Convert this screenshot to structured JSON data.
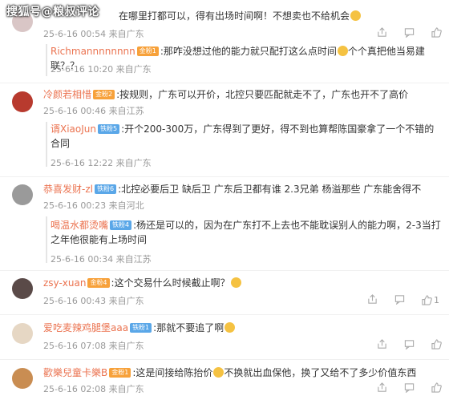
{
  "watermark": "搜狐号@粮叔评论",
  "comments": [
    {
      "avatar_color": "#d9c6c6",
      "text": "在哪里打都可以，得有出场时间啊！不想卖也不给机会",
      "meta": "25-6-16 00:54 来自广东",
      "reply": {
        "name": "Richmannnnnnnn",
        "badge": "金粉1",
        "text": ":那咋没想过他的能力就只配打这么点时间",
        "text_tail": "个个真把他当易建联？？",
        "meta": "25-6-16 10:20 来自广东"
      }
    },
    {
      "avatar_color": "#b83a2e",
      "name": "冷颜若相惜",
      "badge": "金粉2",
      "text": ":按规则，广东可以开价，北控只要匹配就走不了，广东也开不了高价",
      "meta": "25-6-16 00:46 来自江苏",
      "reply": {
        "name": "谞XiaoJun",
        "badge": "铁粉5",
        "text": ":开个200-300万，广东得到了更好，得不到也算帮陈国豪拿了一个不错的合同",
        "meta": "25-6-16 12:22 来自广东"
      }
    },
    {
      "avatar_color": "#9a9a9a",
      "name": "恭喜发财-zl",
      "badge": "铁粉6",
      "text": ":北控必要后卫 缺后卫 广东后卫都有谁 2.3兄弟 杨溢那些 广东能舍得不",
      "meta": "25-6-16 00:23 来自河北",
      "reply": {
        "name": "喝温水都烫嘴",
        "badge": "铁粉4",
        "text": ":杨还是可以的，因为在广东打不上去也不能耽误别人的能力啊，2-3当打之年他很能有上场时间",
        "meta": "25-6-16 00:34 来自江苏"
      }
    },
    {
      "avatar_color": "#5a4a48",
      "name": "zsy-xuan",
      "badge": "金粉4",
      "text": ":这个交易什么时候截止啊？",
      "meta": "25-6-16 00:43 来自广东",
      "likes": "1"
    },
    {
      "avatar_color": "#e6d7c4",
      "name": "爱吃麦辣鸡腿堡aaa",
      "badge": "铁粉1",
      "text": ":那就不要追了啊",
      "meta": "25-6-16 07:08 来自广东"
    },
    {
      "avatar_color": "#c98d52",
      "name": "歡樂兒童卡樂B",
      "badge": "金粉1",
      "text": ":这是间接给陈抬价",
      "text_tail": "不换就出血保他，换了又给不了多少价值东西",
      "meta": "25-6-16 02:08 来自广东"
    }
  ],
  "icons": {
    "share": "share-icon",
    "comment": "comment-icon",
    "like": "thumbs-up-icon"
  },
  "colors": {
    "name": "#eb7350",
    "text": "#333333",
    "meta": "#999999",
    "badge_gold": "#f7a13a",
    "badge_iron": "#5aa7e8"
  }
}
